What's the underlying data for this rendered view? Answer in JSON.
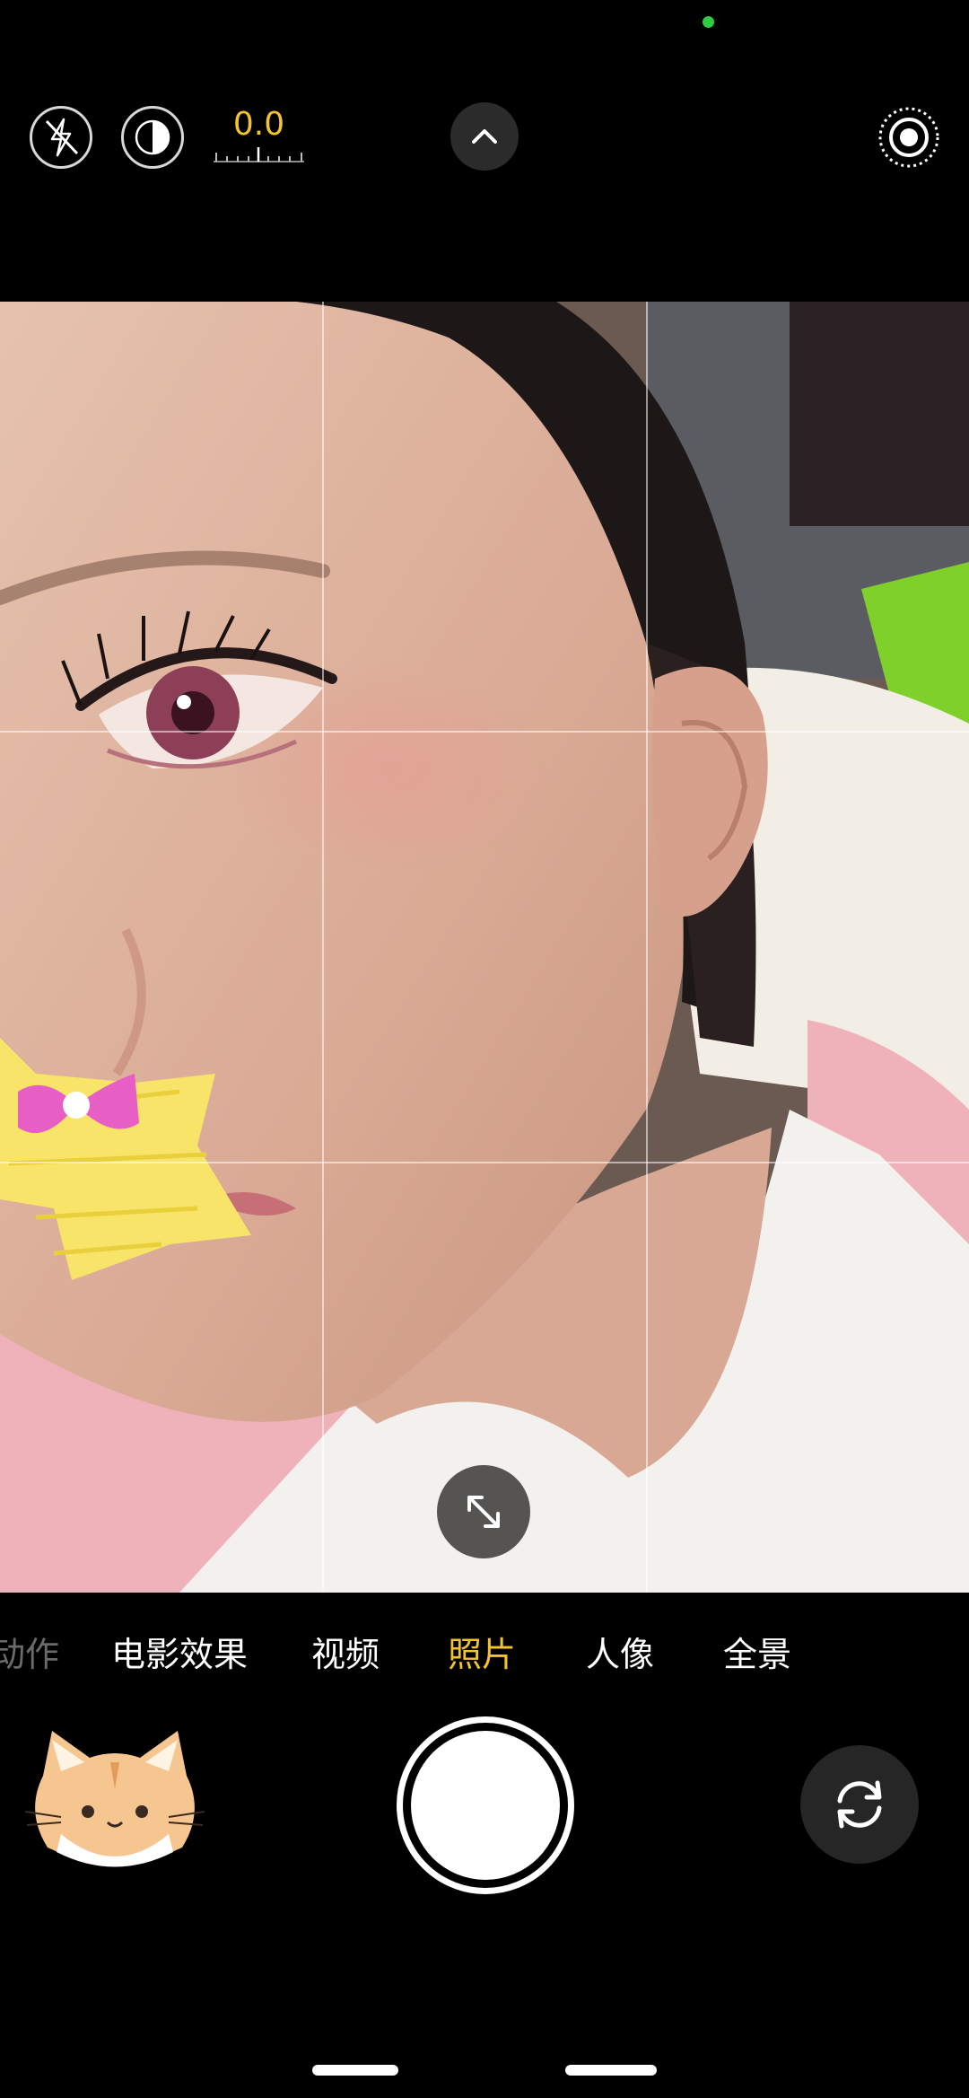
{
  "status": {
    "privacy_dot_color": "#2ecc40"
  },
  "top_bar": {
    "flash_icon": "flash-off-icon",
    "live_icon": "live-photo-icon",
    "exposure_value": "0.0",
    "exposure_color": "#f4c430",
    "chevron_icon": "chevron-up-icon",
    "settings_icon": "camera-settings-icon"
  },
  "viewfinder": {
    "subject": "selfie-preview",
    "grid": "3x3",
    "expand_icon": "expand-arrows-icon"
  },
  "modes": {
    "items": [
      {
        "label": "动作",
        "state": "faded"
      },
      {
        "label": "电影效果",
        "state": "normal"
      },
      {
        "label": "视频",
        "state": "normal"
      },
      {
        "label": "照片",
        "state": "active"
      },
      {
        "label": "人像",
        "state": "normal"
      },
      {
        "label": "全景",
        "state": "normal"
      }
    ],
    "active_color": "#f4c430"
  },
  "bottom_bar": {
    "thumbnail": "cat-sticker-thumbnail",
    "shutter": "shutter-button",
    "flip_icon": "camera-flip-icon"
  }
}
